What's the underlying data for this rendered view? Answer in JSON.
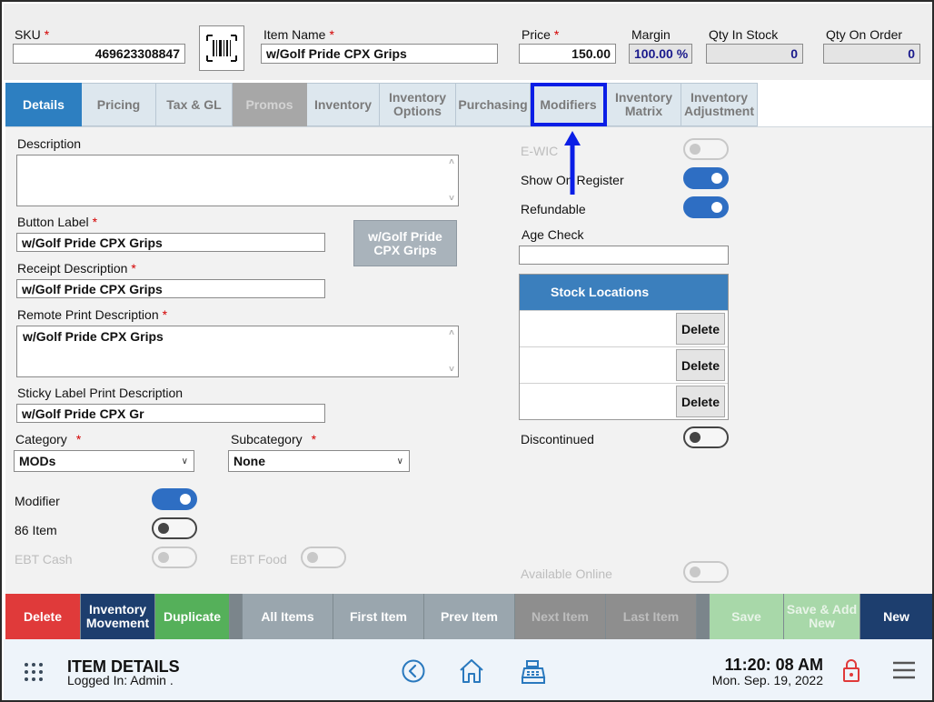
{
  "header": {
    "sku_label": "SKU",
    "sku_value": "469623308847",
    "item_name_label": "Item Name",
    "item_name_value": "w/Golf Pride CPX Grips",
    "price_label": "Price",
    "price_value": "150.00",
    "margin_label": "Margin",
    "margin_value": "100.00 %",
    "qty_in_stock_label": "Qty In Stock",
    "qty_in_stock_value": "0",
    "qty_on_order_label": "Qty On Order",
    "qty_on_order_value": "0",
    "required_mark": "*"
  },
  "tabs": [
    {
      "label": "Details",
      "state": "active"
    },
    {
      "label": "Pricing",
      "state": "normal"
    },
    {
      "label": "Tax & GL",
      "state": "normal"
    },
    {
      "label": "Promos",
      "state": "disabled"
    },
    {
      "label": "Inventory",
      "state": "normal"
    },
    {
      "label": "Inventory Options",
      "state": "normal"
    },
    {
      "label": "Purchasing",
      "state": "normal"
    },
    {
      "label": "Modifiers",
      "state": "highlighted"
    },
    {
      "label": "Inventory Matrix",
      "state": "normal"
    },
    {
      "label": "Inventory Adjustment",
      "state": "normal"
    }
  ],
  "details": {
    "description_label": "Description",
    "description_value": "",
    "button_label_label": "Button Label",
    "button_label_value": "w/Golf Pride CPX Grips",
    "button_preview": "w/Golf Pride CPX Grips",
    "receipt_description_label": "Receipt Description",
    "receipt_description_value": "w/Golf Pride CPX Grips",
    "remote_print_label": "Remote Print Description",
    "remote_print_value": "w/Golf Pride CPX Grips",
    "sticky_label_label": "Sticky Label Print Description",
    "sticky_label_value": "w/Golf Pride CPX Gr",
    "category_label": "Category",
    "category_value": "MODs",
    "subcategory_label": "Subcategory",
    "subcategory_value": "None",
    "modifier_label": "Modifier",
    "modifier_on": true,
    "item86_label": "86 Item",
    "item86_on": false,
    "ebt_cash_label": "EBT Cash",
    "ebt_food_label": "EBT Food"
  },
  "right_panel": {
    "ewic_label": "E-WIC",
    "show_on_register_label": "Show On Register",
    "show_on_register_on": true,
    "refundable_label": "Refundable",
    "refundable_on": true,
    "age_check_label": "Age Check",
    "age_check_value": "",
    "stock_locations_title": "Stock Locations",
    "stock_rows": [
      {
        "name": "",
        "delete_label": "Delete"
      },
      {
        "name": "",
        "delete_label": "Delete"
      },
      {
        "name": "",
        "delete_label": "Delete"
      }
    ],
    "discontinued_label": "Discontinued",
    "discontinued_on": false,
    "available_online_label": "Available Online"
  },
  "bottom_bar": [
    {
      "label": "Delete",
      "color": "#e03a3a",
      "text_color": "#ffffff"
    },
    {
      "label": "Inventory Movement",
      "color": "#1d3e6e",
      "text_color": "#ffffff"
    },
    {
      "label": "Duplicate",
      "color": "#55b05a",
      "text_color": "#ffffff"
    },
    {
      "label": "All Items",
      "color": "#9aa6ae",
      "text_color": "#ffffff"
    },
    {
      "label": "First Item",
      "color": "#9aa6ae",
      "text_color": "#ffffff"
    },
    {
      "label": "Prev Item",
      "color": "#9aa6ae",
      "text_color": "#ffffff"
    },
    {
      "label": "Next Item",
      "color": "#8e8e8e",
      "text_color": "#bdbdbd"
    },
    {
      "label": "Last Item",
      "color": "#8e8e8e",
      "text_color": "#bdbdbd"
    },
    {
      "label": "Save",
      "color": "#a8d8a9",
      "text_color": "#e8f4e8"
    },
    {
      "label": "Save & Add New",
      "color": "#a8d8a9",
      "text_color": "#e8f4e8"
    },
    {
      "label": "New",
      "color": "#1d3e6e",
      "text_color": "#ffffff"
    }
  ],
  "footer": {
    "title": "ITEM DETAILS",
    "logged_in_text": "Logged In:  Admin .",
    "time": "11:20: 08 AM",
    "date": "Mon. Sep. 19, 2022"
  },
  "icons": {
    "grid": "grid-icon",
    "back": "back-circle-icon",
    "home": "home-icon",
    "register": "cash-register-icon",
    "lock": "lock-icon",
    "menu": "hamburger-menu-icon",
    "barcode": "barcode-icon"
  },
  "colors": {
    "accent_blue": "#2d7fc1",
    "highlight_outline": "#0a1ee6",
    "required_red": "#d40000",
    "toggle_on": "#2e6ec3"
  }
}
